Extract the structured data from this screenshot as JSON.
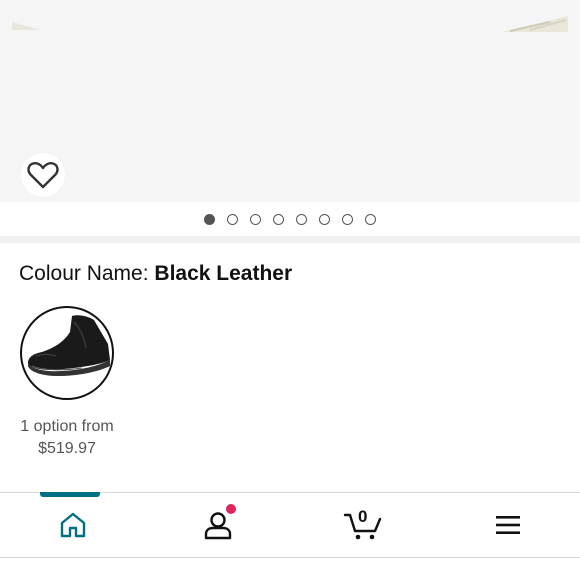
{
  "product": {
    "colour_label": "Colour Name:",
    "colour_value": "Black Leather",
    "option_count_text": "1 option from",
    "option_price": "$519.97"
  },
  "gallery": {
    "total_images": 8,
    "active_index": 0
  },
  "nav": {
    "items": [
      "home-icon",
      "account-icon",
      "cart-icon",
      "menu-icon"
    ],
    "active": "home",
    "cart_count": "0"
  },
  "colors": {
    "accent": "#007185",
    "badge": "#e0245e",
    "image_bg": "#f5f5f5"
  }
}
